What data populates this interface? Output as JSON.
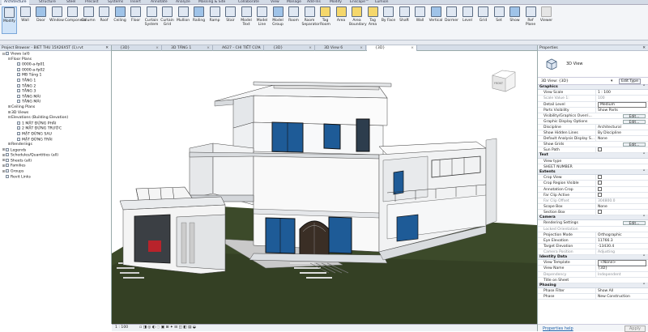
{
  "menu_tabs": [
    "Architecture",
    "Structure",
    "Steel",
    "Precast",
    "Systems",
    "Insert",
    "Annotate",
    "Analyze",
    "Massing & Site",
    "Collaborate",
    "View",
    "Manage",
    "Add-Ins",
    "Modify",
    "Enscape™",
    "Lumion"
  ],
  "ribbon_tools": [
    {
      "label": "Modify",
      "icon": "cursor-arrow-icon"
    },
    {
      "label": "Wall",
      "icon": "wall-icon"
    },
    {
      "label": "Door",
      "icon": "door-icon"
    },
    {
      "label": "Window",
      "icon": "window-icon"
    },
    {
      "label": "Component",
      "icon": "component-icon"
    },
    {
      "label": "Column",
      "icon": "column-icon"
    },
    {
      "label": "Roof",
      "icon": "roof-icon"
    },
    {
      "label": "Ceiling",
      "icon": "ceiling-icon"
    },
    {
      "label": "Floor",
      "icon": "floor-icon"
    },
    {
      "label": "Curtain System",
      "icon": "curtain-system-icon"
    },
    {
      "label": "Curtain Grid",
      "icon": "curtain-grid-icon"
    },
    {
      "label": "Mullion",
      "icon": "mullion-icon"
    },
    {
      "label": "Railing",
      "icon": "railing-icon"
    },
    {
      "label": "Ramp",
      "icon": "ramp-icon"
    },
    {
      "label": "Stair",
      "icon": "stair-icon"
    },
    {
      "label": "Model Text",
      "icon": "model-text-icon"
    },
    {
      "label": "Model Line",
      "icon": "model-line-icon"
    },
    {
      "label": "Model Group",
      "icon": "model-group-icon"
    },
    {
      "label": "Room",
      "icon": "room-icon"
    },
    {
      "label": "Room Separator",
      "icon": "room-separator-icon"
    },
    {
      "label": "Tag Room",
      "icon": "tag-room-icon"
    },
    {
      "label": "Area",
      "icon": "area-icon"
    },
    {
      "label": "Area Boundary",
      "icon": "area-boundary-icon"
    },
    {
      "label": "Tag Area",
      "icon": "tag-area-icon"
    },
    {
      "label": "By Face",
      "icon": "by-face-icon"
    },
    {
      "label": "Shaft",
      "icon": "shaft-icon"
    },
    {
      "label": "Wall",
      "icon": "opening-wall-icon"
    },
    {
      "label": "Vertical",
      "icon": "vertical-opening-icon"
    },
    {
      "label": "Dormer",
      "icon": "dormer-icon"
    },
    {
      "label": "Level",
      "icon": "level-icon"
    },
    {
      "label": "Grid",
      "icon": "grid-icon"
    },
    {
      "label": "Set",
      "icon": "set-workplane-icon"
    },
    {
      "label": "Show",
      "icon": "show-workplane-icon"
    },
    {
      "label": "Ref Plane",
      "icon": "ref-plane-icon"
    },
    {
      "label": "Viewer",
      "icon": "viewer-icon"
    }
  ],
  "project_browser": {
    "title": "Project Browser - BIET THU 15X26X5T (1).rvt",
    "items": [
      {
        "label": "Views (all)",
        "level": 0,
        "toggle": "⊟",
        "icon": true
      },
      {
        "label": "Floor Plans",
        "level": 1,
        "toggle": "⊟",
        "icon": false
      },
      {
        "label": "0000-a-fp01",
        "level": 2,
        "toggle": "",
        "icon": true
      },
      {
        "label": "0000-a-fp02",
        "level": 2,
        "toggle": "",
        "icon": true
      },
      {
        "label": "MB Tầng 1",
        "level": 2,
        "toggle": "",
        "icon": true
      },
      {
        "label": "TẦNG 1",
        "level": 2,
        "toggle": "",
        "icon": true
      },
      {
        "label": "TẦNG 2",
        "level": 2,
        "toggle": "",
        "icon": true
      },
      {
        "label": "TẦNG 3",
        "level": 2,
        "toggle": "",
        "icon": true
      },
      {
        "label": "TẦNG MÁI",
        "level": 2,
        "toggle": "",
        "icon": true
      },
      {
        "label": "TẦNG MÁI",
        "level": 2,
        "toggle": "",
        "icon": true
      },
      {
        "label": "Ceiling Plans",
        "level": 1,
        "toggle": "⊞",
        "icon": false
      },
      {
        "label": "3D Views",
        "level": 1,
        "toggle": "⊞",
        "icon": false
      },
      {
        "label": "Elevations (Building Elevation)",
        "level": 1,
        "toggle": "⊟",
        "icon": false
      },
      {
        "label": "1 MẶT ĐỨNG PHẢI",
        "level": 2,
        "toggle": "",
        "icon": true
      },
      {
        "label": "2 MẶT ĐỨNG TRƯỚC",
        "level": 2,
        "toggle": "",
        "icon": true
      },
      {
        "label": "MẶT ĐỨNG SAU",
        "level": 2,
        "toggle": "",
        "icon": true
      },
      {
        "label": "MẶT ĐỨNG TRÁI",
        "level": 2,
        "toggle": "",
        "icon": true
      },
      {
        "label": "Renderings",
        "level": 1,
        "toggle": "⊞",
        "icon": false
      },
      {
        "label": "Legends",
        "level": 0,
        "toggle": "⊞",
        "icon": true
      },
      {
        "label": "Schedules/Quantities (all)",
        "level": 0,
        "toggle": "⊞",
        "icon": true
      },
      {
        "label": "Sheets (all)",
        "level": 0,
        "toggle": "⊞",
        "icon": true
      },
      {
        "label": "Families",
        "level": 0,
        "toggle": "⊞",
        "icon": true
      },
      {
        "label": "Groups",
        "level": 0,
        "toggle": "⊞",
        "icon": true
      },
      {
        "label": "Revit Links",
        "level": 0,
        "toggle": "",
        "icon": true
      }
    ]
  },
  "view_tabs": [
    {
      "label": "{3D}"
    },
    {
      "label": "3D TẦNG 1"
    },
    {
      "label": "A627 - CHI TIẾT CỬA"
    },
    {
      "label": "{3D}"
    },
    {
      "label": "3D View 6"
    },
    {
      "label": "{3D}"
    }
  ],
  "view_bar": {
    "scale": "1 : 100"
  },
  "viewcube": {
    "label": "FRONT"
  },
  "properties": {
    "title": "Properties",
    "type_name": "3D View",
    "filter_value": "3D View: {3D}",
    "edit_type": "Edit Type",
    "groups": [
      {
        "name": "Graphics",
        "rows": [
          {
            "k": "View Scale",
            "v": "1 : 100"
          },
          {
            "k": "Scale Value  1:",
            "v": "100",
            "dim": true
          },
          {
            "k": "Detail Level",
            "v": "Medium",
            "box": true
          },
          {
            "k": "Parts Visibility",
            "v": "Show Parts"
          },
          {
            "k": "Visibility/Graphics Overri...",
            "btn": "Edit..."
          },
          {
            "k": "Graphic Display Options",
            "btn": "Edit..."
          },
          {
            "k": "Discipline",
            "v": "Architectural"
          },
          {
            "k": "Show Hidden Lines",
            "v": "By Discipline"
          },
          {
            "k": "Default Analysis Display S...",
            "v": "None"
          },
          {
            "k": "Show Grids",
            "btn": "Edit..."
          },
          {
            "k": "Sun Path",
            "chk": true
          }
        ]
      },
      {
        "name": "Text",
        "rows": [
          {
            "k": "View type",
            "v": ""
          },
          {
            "k": "SHEET NUMBER",
            "v": ""
          }
        ]
      },
      {
        "name": "Extents",
        "rows": [
          {
            "k": "Crop View",
            "chk": true
          },
          {
            "k": "Crop Region Visible",
            "chk": true
          },
          {
            "k": "Annotation Crop",
            "chk": true
          },
          {
            "k": "Far Clip Active",
            "chk": true
          },
          {
            "k": "Far Clip Offset",
            "v": "304800.0",
            "dim": true
          },
          {
            "k": "Scope Box",
            "v": "None"
          },
          {
            "k": "Section Box",
            "chk": true
          }
        ]
      },
      {
        "name": "Camera",
        "rows": [
          {
            "k": "Rendering Settings",
            "btn": "Edit..."
          },
          {
            "k": "Locked Orientation",
            "v": "",
            "dim": true
          },
          {
            "k": "Projection Mode",
            "v": "Orthographic"
          },
          {
            "k": "Eye Elevation",
            "v": "11766.3"
          },
          {
            "k": "Target Elevation",
            "v": "-13430.4"
          },
          {
            "k": "Camera Position",
            "v": "Adjusting",
            "dim": true
          }
        ]
      },
      {
        "name": "Identity Data",
        "rows": [
          {
            "k": "View Template",
            "v": "<None>",
            "box": true
          },
          {
            "k": "View Name",
            "v": "{3D}"
          },
          {
            "k": "Dependency",
            "v": "Independent",
            "dim": true
          },
          {
            "k": "Title on Sheet",
            "v": ""
          }
        ]
      },
      {
        "name": "Phasing",
        "rows": [
          {
            "k": "Phase Filter",
            "v": "Show All"
          },
          {
            "k": "Phase",
            "v": "New Construction"
          }
        ]
      }
    ],
    "help_link": "Properties help",
    "apply": "Apply"
  }
}
